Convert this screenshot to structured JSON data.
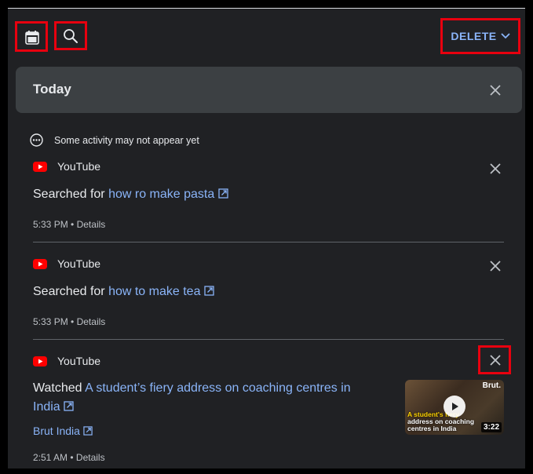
{
  "toolbar": {
    "calendar_icon": "calendar-icon",
    "search_icon": "search-icon",
    "delete_label": "DELETE"
  },
  "today": {
    "title": "Today"
  },
  "notice": {
    "text": "Some activity may not appear yet"
  },
  "entries": [
    {
      "source": "YouTube",
      "action": "Searched for",
      "query": "how ro make pasta",
      "time": "5:33 PM",
      "details": "Details"
    },
    {
      "source": "YouTube",
      "action": "Searched for",
      "query": "how to make tea",
      "time": "5:33 PM",
      "details": "Details"
    },
    {
      "source": "YouTube",
      "action": "Watched",
      "title_part1": "A student’s fiery address on coaching centres in",
      "title_part2": "India",
      "channel": "Brut India",
      "time": "2:51 AM",
      "details": "Details",
      "thumb_brand": "Brut.",
      "thumb_caption_1": "A student's fiery",
      "thumb_caption_2": "address on coaching",
      "thumb_caption_3": "centres in India",
      "duration": "3:22"
    }
  ],
  "colors": {
    "background": "#202124",
    "link": "#8ab4f8",
    "highlight_box": "#e8000f",
    "youtube_red": "#ff0000"
  }
}
